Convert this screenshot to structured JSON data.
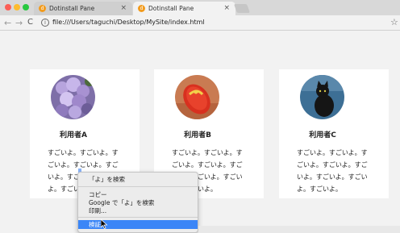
{
  "tabs": [
    {
      "title": "Dotinstall Pane",
      "favicon": "d",
      "active": false,
      "close": "×"
    },
    {
      "title": "Dotinstall Pane",
      "favicon": "d",
      "active": true,
      "close": "×"
    }
  ],
  "toolbar": {
    "url": "file:///Users/taguchi/Desktop/MySite/index.html",
    "back_icon": "←",
    "forward_icon": "→",
    "reload_icon": "C",
    "info_icon": "i",
    "star_icon": "☆"
  },
  "cards": [
    {
      "name": "利用者A",
      "text": "すごいよ。すごいよ。すごいよ。すごいよ。すごいよ。すごいよ。すごいよ。すごいよ。",
      "avatar": "hydrangea"
    },
    {
      "name": "利用者B",
      "text": "すごいよ。すごいよ。すごいよ。すごいよ。すごいよ。すごいよ。すごいよ。すごいよ。",
      "avatar": "red-sandal"
    },
    {
      "name": "利用者C",
      "text": "すごいよ。すごいよ。すごいよ。すごいよ。すごいよ。すごいよ。すごいよ。すごいよ。",
      "avatar": "black-cat"
    }
  ],
  "context_menu": {
    "search": "「よ」を検索",
    "copy": "コピー",
    "google_search": "Google で「よ」を検索",
    "print": "印刷...",
    "inspect": "検証"
  }
}
